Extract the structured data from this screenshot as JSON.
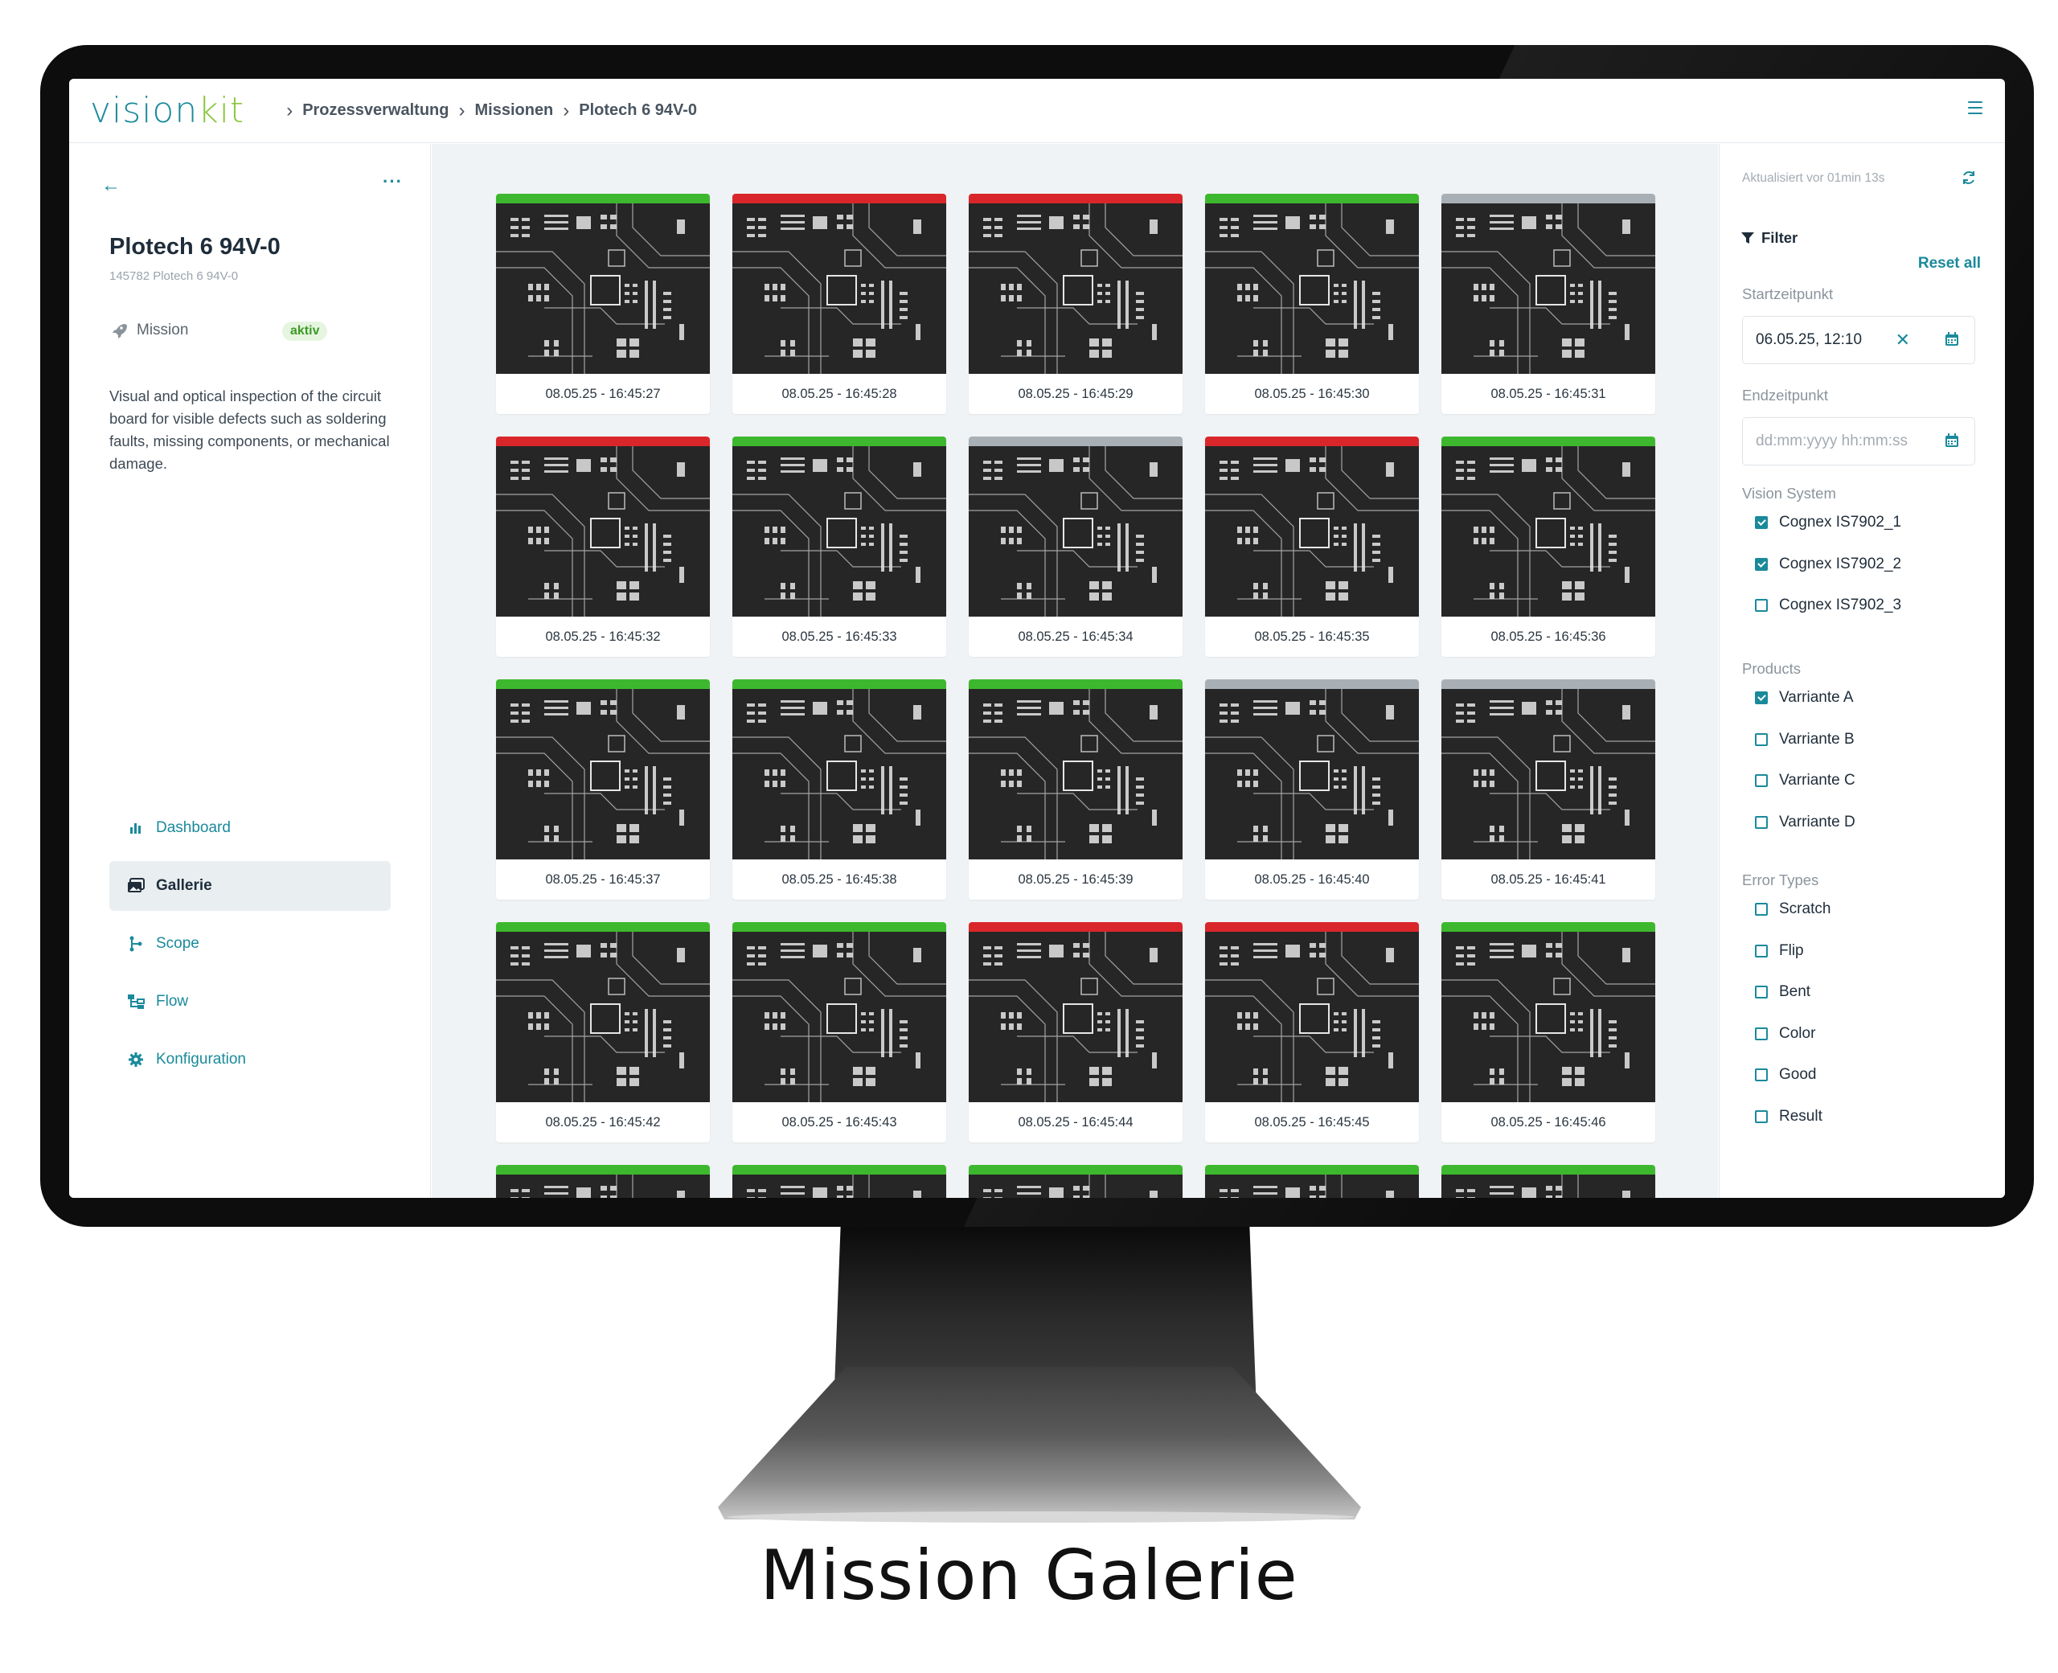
{
  "app": {
    "logo_part1": "vision",
    "logo_part2": "kit",
    "breadcrumb": [
      "Prozessverwaltung",
      "Missionen",
      "Plotech 6 94V-0"
    ]
  },
  "mission": {
    "title": "Plotech 6 94V-0",
    "subtitle": "145782 Plotech 6 94V-0",
    "type_label": "Mission",
    "status": "aktiv",
    "description": "Visual and optical inspection of the circuit board for visible defects such as soldering faults, missing components, or mechanical damage."
  },
  "nav": [
    {
      "label": "Dashboard",
      "icon": "bar-chart-icon",
      "active": false
    },
    {
      "label": "Gallerie",
      "icon": "gallery-icon",
      "active": true
    },
    {
      "label": "Scope",
      "icon": "scope-icon",
      "active": false
    },
    {
      "label": "Flow",
      "icon": "flow-icon",
      "active": false
    },
    {
      "label": "Konfiguration",
      "icon": "gear-icon",
      "active": false
    }
  ],
  "gallery": {
    "status_colors": {
      "ok": "#3db82e",
      "nok": "#d9262a",
      "none": "#a9b0b5"
    },
    "items": [
      {
        "timestamp": "08.05.25 - 16:45:27",
        "status": "ok"
      },
      {
        "timestamp": "08.05.25 - 16:45:28",
        "status": "nok"
      },
      {
        "timestamp": "08.05.25 - 16:45:29",
        "status": "nok"
      },
      {
        "timestamp": "08.05.25 - 16:45:30",
        "status": "ok"
      },
      {
        "timestamp": "08.05.25 - 16:45:31",
        "status": "none"
      },
      {
        "timestamp": "08.05.25 - 16:45:32",
        "status": "nok"
      },
      {
        "timestamp": "08.05.25 - 16:45:33",
        "status": "ok"
      },
      {
        "timestamp": "08.05.25 - 16:45:34",
        "status": "none"
      },
      {
        "timestamp": "08.05.25 - 16:45:35",
        "status": "nok"
      },
      {
        "timestamp": "08.05.25 - 16:45:36",
        "status": "ok"
      },
      {
        "timestamp": "08.05.25 - 16:45:37",
        "status": "ok"
      },
      {
        "timestamp": "08.05.25 - 16:45:38",
        "status": "ok"
      },
      {
        "timestamp": "08.05.25 - 16:45:39",
        "status": "ok"
      },
      {
        "timestamp": "08.05.25 - 16:45:40",
        "status": "none"
      },
      {
        "timestamp": "08.05.25 - 16:45:41",
        "status": "none"
      },
      {
        "timestamp": "08.05.25 - 16:45:42",
        "status": "ok"
      },
      {
        "timestamp": "08.05.25 - 16:45:43",
        "status": "ok"
      },
      {
        "timestamp": "08.05.25 - 16:45:44",
        "status": "nok"
      },
      {
        "timestamp": "08.05.25 - 16:45:45",
        "status": "nok"
      },
      {
        "timestamp": "08.05.25 - 16:45:46",
        "status": "ok"
      },
      {
        "timestamp": "",
        "status": "ok"
      },
      {
        "timestamp": "",
        "status": "ok"
      },
      {
        "timestamp": "",
        "status": "ok"
      },
      {
        "timestamp": "",
        "status": "ok"
      },
      {
        "timestamp": "",
        "status": "ok"
      }
    ]
  },
  "filters": {
    "updated_text": "Aktualisiert vor 01min 13s",
    "title": "Filter",
    "reset_label": "Reset all",
    "start_label": "Startzeitpunkt",
    "start_value": "06.05.25, 12:10",
    "end_label": "Endzeitpunkt",
    "end_placeholder": "dd:mm:yyyy  hh:mm:ss",
    "groups": [
      {
        "label": "Vision System",
        "options": [
          {
            "label": "Cognex IS7902_1",
            "checked": true
          },
          {
            "label": "Cognex IS7902_2",
            "checked": true
          },
          {
            "label": "Cognex IS7902_3",
            "checked": false
          }
        ]
      },
      {
        "label": "Products",
        "options": [
          {
            "label": "Varriante A",
            "checked": true
          },
          {
            "label": "Varriante B",
            "checked": false
          },
          {
            "label": "Varriante C",
            "checked": false
          },
          {
            "label": "Varriante D",
            "checked": false
          }
        ]
      },
      {
        "label": "Error Types",
        "options": [
          {
            "label": "Scratch",
            "checked": false
          },
          {
            "label": "Flip",
            "checked": false
          },
          {
            "label": "Bent",
            "checked": false
          },
          {
            "label": "Color",
            "checked": false
          },
          {
            "label": "Good",
            "checked": false
          },
          {
            "label": "Result",
            "checked": false
          }
        ]
      }
    ]
  },
  "caption": "Mission Galerie"
}
